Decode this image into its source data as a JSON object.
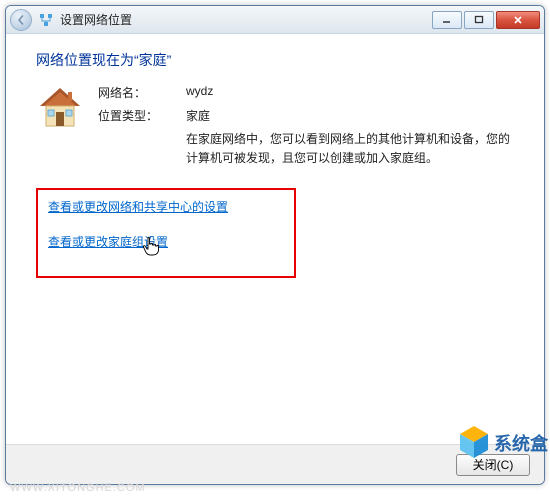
{
  "titlebar": {
    "title": "设置网络位置"
  },
  "content": {
    "heading": "网络位置现在为“家庭”",
    "network_name_label": "网络名：",
    "network_name_value": "wydz",
    "location_type_label": "位置类型：",
    "location_type_value": "家庭",
    "description": "在家庭网络中，您可以看到网络上的其他计算机和设备，您的计算机可被发现，且您可以创建或加入家庭组。",
    "link_network_sharing": "查看或更改网络和共享中心的设置",
    "link_homegroup": "查看或更改家庭组设置"
  },
  "footer": {
    "close_button": "关闭(C)"
  },
  "watermark": "WWW.XITONGHE.COM",
  "brand": "系统盒"
}
